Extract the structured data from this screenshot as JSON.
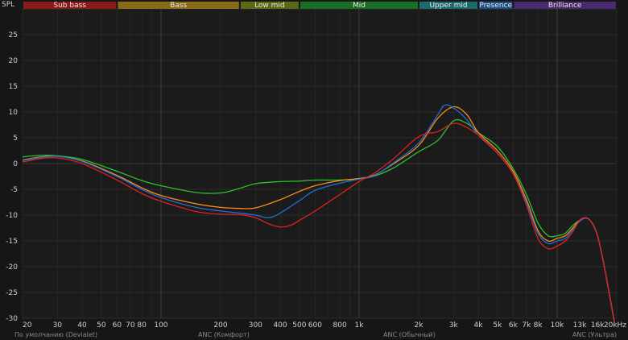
{
  "chart_data": {
    "type": "line",
    "ylabel": "SPL",
    "xunit": "kHz",
    "xscale": "log",
    "xlim": [
      20,
      20000
    ],
    "ylim": [
      -30,
      30
    ],
    "grid": true,
    "x_ticks": [
      {
        "v": 20,
        "label": "20"
      },
      {
        "v": 30,
        "label": "30"
      },
      {
        "v": 40,
        "label": "40"
      },
      {
        "v": 50,
        "label": "50"
      },
      {
        "v": 60,
        "label": "60"
      },
      {
        "v": 70,
        "label": "70"
      },
      {
        "v": 80,
        "label": "80"
      },
      {
        "v": 100,
        "label": "100"
      },
      {
        "v": 200,
        "label": "200"
      },
      {
        "v": 300,
        "label": "300"
      },
      {
        "v": 400,
        "label": "400"
      },
      {
        "v": 500,
        "label": "500"
      },
      {
        "v": 600,
        "label": "600"
      },
      {
        "v": 800,
        "label": "800"
      },
      {
        "v": 1000,
        "label": "1k"
      },
      {
        "v": 2000,
        "label": "2k"
      },
      {
        "v": 3000,
        "label": "3k"
      },
      {
        "v": 4000,
        "label": "4k"
      },
      {
        "v": 5000,
        "label": "5k"
      },
      {
        "v": 6000,
        "label": "6k"
      },
      {
        "v": 7000,
        "label": "7k"
      },
      {
        "v": 8000,
        "label": "8k"
      },
      {
        "v": 10000,
        "label": "10k"
      },
      {
        "v": 13000,
        "label": "13k"
      },
      {
        "v": 16000,
        "label": "16k"
      },
      {
        "v": 20000,
        "label": "20kHz"
      }
    ],
    "y_ticks": [
      25,
      20,
      15,
      10,
      5,
      0,
      -5,
      -10,
      -15,
      -20,
      -25,
      -30
    ],
    "bands": [
      {
        "name": "Sub bass",
        "from": 20,
        "to": 60,
        "color": "#8b1a1a"
      },
      {
        "name": "Bass",
        "from": 60,
        "to": 250,
        "color": "#8a6a14"
      },
      {
        "name": "Low mid",
        "from": 250,
        "to": 500,
        "color": "#5a6a14"
      },
      {
        "name": "Mid",
        "from": 500,
        "to": 2000,
        "color": "#1a6e24"
      },
      {
        "name": "Upper mid",
        "from": 2000,
        "to": 4000,
        "color": "#1d6a6e"
      },
      {
        "name": "Presence",
        "from": 4000,
        "to": 6000,
        "color": "#1e4f86"
      },
      {
        "name": "Brilliance",
        "from": 6000,
        "to": 20000,
        "color": "#4a2a6e"
      }
    ],
    "series": [
      {
        "name": "По умолчанию (Devialet)",
        "color": "#2fbf2f",
        "points": [
          [
            20,
            1.3
          ],
          [
            25,
            1.6
          ],
          [
            30,
            1.5
          ],
          [
            40,
            0.8
          ],
          [
            60,
            -1.5
          ],
          [
            80,
            -3.3
          ],
          [
            100,
            -4.3
          ],
          [
            150,
            -5.6
          ],
          [
            200,
            -5.7
          ],
          [
            250,
            -4.8
          ],
          [
            300,
            -3.9
          ],
          [
            400,
            -3.5
          ],
          [
            500,
            -3.4
          ],
          [
            600,
            -3.2
          ],
          [
            800,
            -3.2
          ],
          [
            1000,
            -3.0
          ],
          [
            1200,
            -2.4
          ],
          [
            1500,
            -0.8
          ],
          [
            2000,
            2.3
          ],
          [
            2500,
            4.5
          ],
          [
            3000,
            8.3
          ],
          [
            3500,
            7.8
          ],
          [
            4000,
            6.0
          ],
          [
            5000,
            3.3
          ],
          [
            6000,
            -1.0
          ],
          [
            7000,
            -6.0
          ],
          [
            8000,
            -11.5
          ],
          [
            9000,
            -14.0
          ],
          [
            10000,
            -14.0
          ],
          [
            11000,
            -13.5
          ],
          [
            12000,
            -12.0
          ],
          [
            13000,
            -11.0
          ],
          [
            14000,
            -10.5
          ],
          [
            15000,
            -11.5
          ],
          [
            16000,
            -14.0
          ],
          [
            17000,
            -18.5
          ],
          [
            18000,
            -23.5
          ],
          [
            19000,
            -28.5
          ],
          [
            19500,
            -31.0
          ]
        ]
      },
      {
        "name": "ANC (Комфорт)",
        "color": "#ff8c1a",
        "points": [
          [
            20,
            0.7
          ],
          [
            25,
            1.3
          ],
          [
            30,
            1.4
          ],
          [
            40,
            0.5
          ],
          [
            60,
            -2.3
          ],
          [
            80,
            -4.7
          ],
          [
            100,
            -6.2
          ],
          [
            150,
            -7.8
          ],
          [
            200,
            -8.5
          ],
          [
            250,
            -8.7
          ],
          [
            300,
            -8.6
          ],
          [
            400,
            -7.0
          ],
          [
            500,
            -5.4
          ],
          [
            600,
            -4.3
          ],
          [
            800,
            -3.3
          ],
          [
            1000,
            -2.9
          ],
          [
            1200,
            -2.2
          ],
          [
            1500,
            0.0
          ],
          [
            2000,
            3.5
          ],
          [
            2500,
            8.8
          ],
          [
            3000,
            11.0
          ],
          [
            3500,
            9.5
          ],
          [
            4000,
            6.0
          ],
          [
            5000,
            2.5
          ],
          [
            6000,
            -1.5
          ],
          [
            7000,
            -7.0
          ],
          [
            8000,
            -13.0
          ],
          [
            9000,
            -15.0
          ],
          [
            10000,
            -14.5
          ],
          [
            11000,
            -14.0
          ],
          [
            12000,
            -12.5
          ],
          [
            13000,
            -11.0
          ],
          [
            14000,
            -10.5
          ],
          [
            15000,
            -11.5
          ],
          [
            16000,
            -14.0
          ],
          [
            17000,
            -18.5
          ],
          [
            18000,
            -23.5
          ],
          [
            19000,
            -28.5
          ],
          [
            19500,
            -31.0
          ]
        ]
      },
      {
        "name": "ANC (Обычный)",
        "color": "#1f6fd6",
        "points": [
          [
            20,
            0.6
          ],
          [
            25,
            1.2
          ],
          [
            30,
            1.4
          ],
          [
            40,
            0.4
          ],
          [
            60,
            -2.5
          ],
          [
            80,
            -5.0
          ],
          [
            100,
            -6.6
          ],
          [
            150,
            -8.5
          ],
          [
            200,
            -9.2
          ],
          [
            250,
            -9.6
          ],
          [
            300,
            -10.0
          ],
          [
            350,
            -10.5
          ],
          [
            400,
            -9.6
          ],
          [
            500,
            -7.2
          ],
          [
            600,
            -5.2
          ],
          [
            800,
            -3.8
          ],
          [
            1000,
            -3.0
          ],
          [
            1200,
            -2.3
          ],
          [
            1500,
            0.2
          ],
          [
            2000,
            4.0
          ],
          [
            2500,
            9.5
          ],
          [
            2700,
            11.3
          ],
          [
            3000,
            10.8
          ],
          [
            3500,
            8.5
          ],
          [
            4000,
            5.5
          ],
          [
            5000,
            2.0
          ],
          [
            6000,
            -2.0
          ],
          [
            7000,
            -7.5
          ],
          [
            8000,
            -13.5
          ],
          [
            9000,
            -15.5
          ],
          [
            10000,
            -15.0
          ],
          [
            11000,
            -14.5
          ],
          [
            12000,
            -12.8
          ],
          [
            13000,
            -11.2
          ],
          [
            14000,
            -10.6
          ],
          [
            15000,
            -11.5
          ],
          [
            16000,
            -14.0
          ],
          [
            17000,
            -18.5
          ],
          [
            18000,
            -23.5
          ],
          [
            19000,
            -28.5
          ],
          [
            19500,
            -31.0
          ]
        ]
      },
      {
        "name": "ANC (Ультра)",
        "color": "#e02020",
        "points": [
          [
            20,
            0.3
          ],
          [
            25,
            1.0
          ],
          [
            30,
            1.1
          ],
          [
            40,
            0.0
          ],
          [
            60,
            -3.2
          ],
          [
            80,
            -5.8
          ],
          [
            100,
            -7.3
          ],
          [
            150,
            -9.3
          ],
          [
            200,
            -9.8
          ],
          [
            250,
            -9.9
          ],
          [
            300,
            -10.5
          ],
          [
            350,
            -11.7
          ],
          [
            400,
            -12.3
          ],
          [
            450,
            -12.0
          ],
          [
            500,
            -11.0
          ],
          [
            600,
            -9.2
          ],
          [
            800,
            -6.0
          ],
          [
            1000,
            -3.5
          ],
          [
            1200,
            -1.8
          ],
          [
            1500,
            1.0
          ],
          [
            2000,
            5.2
          ],
          [
            2500,
            6.2
          ],
          [
            3000,
            7.8
          ],
          [
            3500,
            7.0
          ],
          [
            4000,
            5.5
          ],
          [
            5000,
            2.0
          ],
          [
            6000,
            -2.0
          ],
          [
            7000,
            -8.0
          ],
          [
            8000,
            -14.5
          ],
          [
            9000,
            -16.5
          ],
          [
            10000,
            -16.0
          ],
          [
            11000,
            -15.0
          ],
          [
            12000,
            -13.2
          ],
          [
            13000,
            -11.0
          ],
          [
            14000,
            -10.5
          ],
          [
            15000,
            -11.5
          ],
          [
            16000,
            -14.0
          ],
          [
            17000,
            -18.5
          ],
          [
            18000,
            -23.5
          ],
          [
            19000,
            -28.5
          ],
          [
            19500,
            -31.0
          ]
        ]
      }
    ]
  }
}
